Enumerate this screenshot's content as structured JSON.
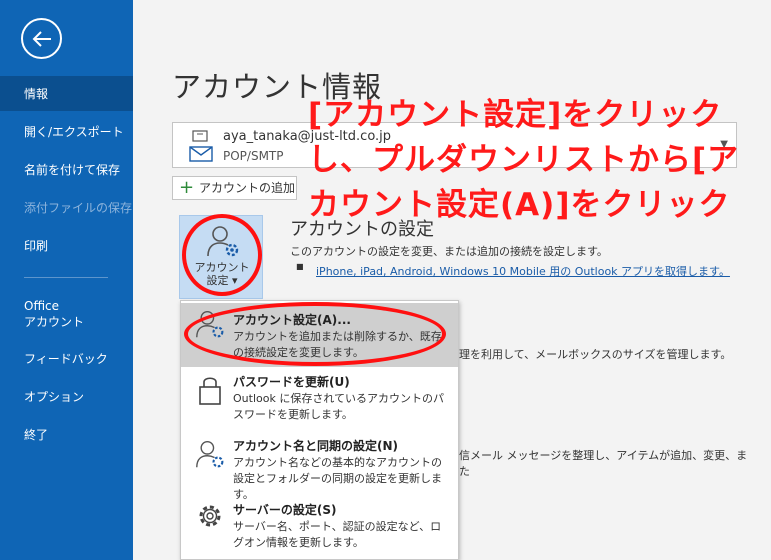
{
  "sidebar": {
    "items": [
      {
        "label": "情報",
        "selected": true
      },
      {
        "label": "開く/エクスポート"
      },
      {
        "label": "名前を付けて保存"
      },
      {
        "label": "添付ファイルの保存",
        "disabled": true
      },
      {
        "label": "印刷"
      },
      {
        "label": "Office\nアカウント"
      },
      {
        "label": "フィードバック"
      },
      {
        "label": "オプション"
      },
      {
        "label": "終了"
      }
    ]
  },
  "main": {
    "title": "アカウント情報",
    "account": {
      "email": "aya_tanaka@just-ltd.co.jp",
      "type": "POP/SMTP"
    },
    "add_account_label": "アカウントの追加",
    "settings_button_label": "アカウント\n設定 ▾",
    "section_title": "アカウントの設定",
    "section_desc": "このアカウントの設定を変更、または追加の接続を設定します。",
    "section_link": "iPhone, iPad, Android, Windows 10 Mobile 用の Outlook アプリを取得します。",
    "bg_text_1": "理を利用して、メールボックスのサイズを管理します。",
    "bg_text_2": "信メール メッセージを整理し、アイテムが追加、変更、ま",
    "bg_text_3": "た"
  },
  "dropdown": {
    "items": [
      {
        "title": "アカウント設定(A)...",
        "desc": "アカウントを追加または削除するか、既存の接続設定を変更します。",
        "icon": "account-settings-icon"
      },
      {
        "title": "パスワードを更新(U)",
        "desc": "Outlook に保存されているアカウントのパスワードを更新します。",
        "icon": "lock-icon"
      },
      {
        "title": "アカウント名と同期の設定(N)",
        "desc": "アカウント名などの基本的なアカウントの設定とフォルダーの同期の設定を更新します。",
        "icon": "account-sync-icon"
      },
      {
        "title": "サーバーの設定(S)",
        "desc": "サーバー名、ポート、認証の設定など、ログオン情報を更新します。",
        "icon": "gear-icon"
      }
    ]
  },
  "annotation": {
    "text": "[アカウント設定]をクリックし、プルダウンリストから[アカウント設定(A)]をクリック",
    "color": "#ff1a1a"
  },
  "colors": {
    "sidebar": "#0f65b5",
    "sidebar_selected": "#0b4f8f",
    "accent_button": "#c5dcf3"
  }
}
